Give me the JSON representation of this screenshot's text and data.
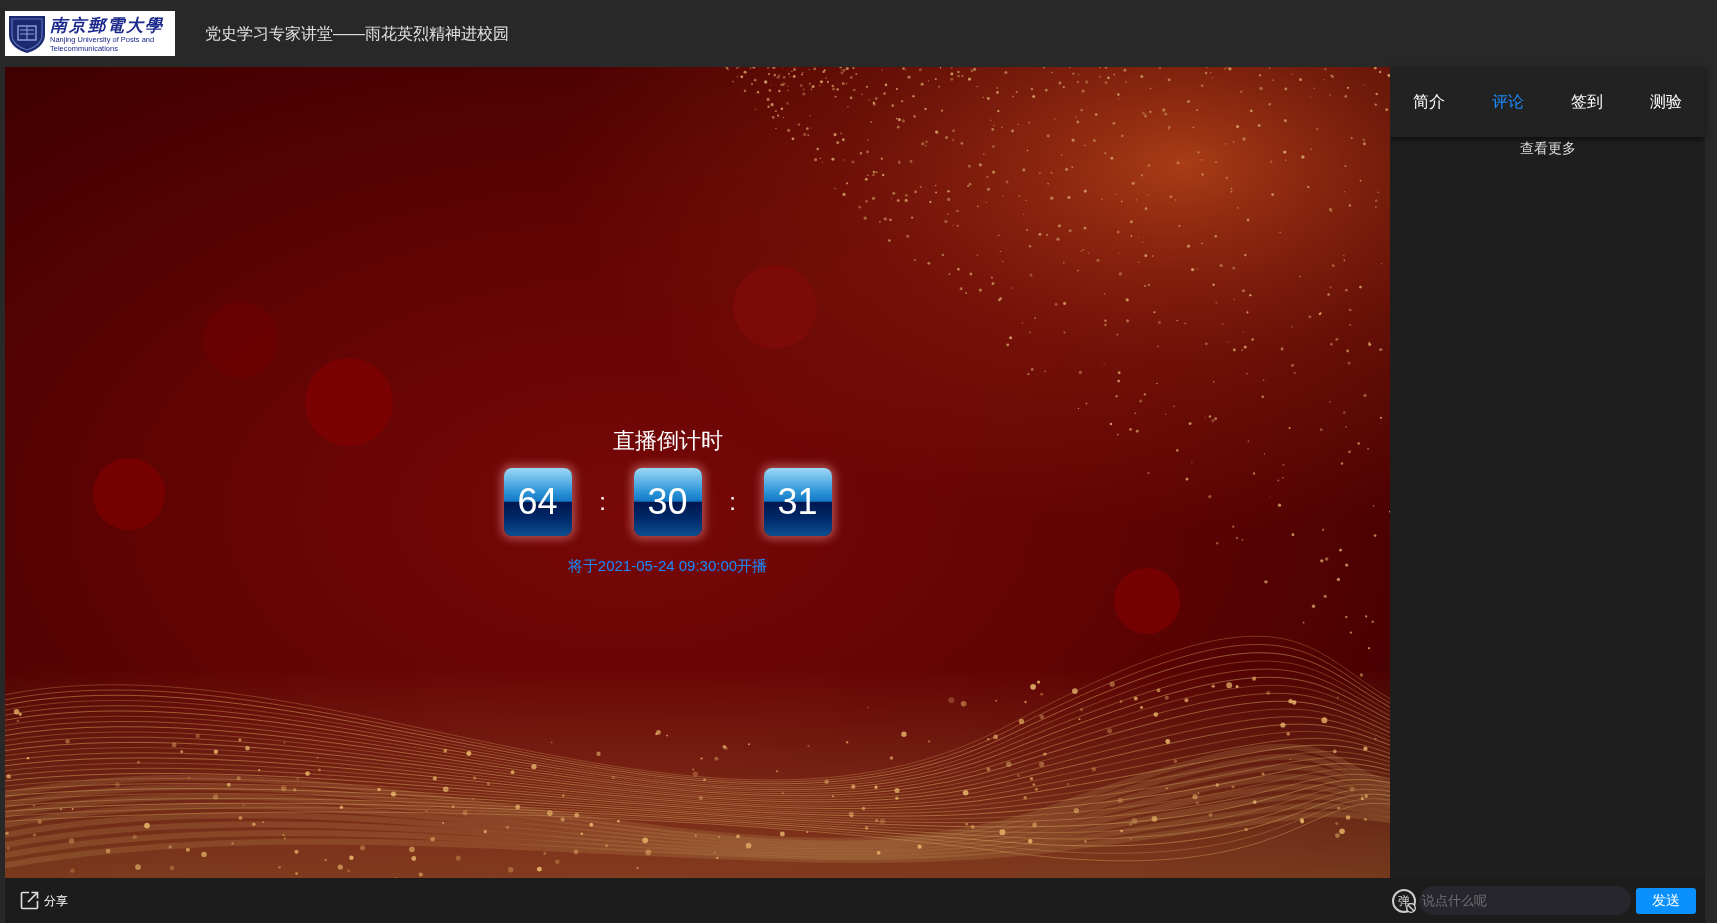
{
  "header": {
    "logo": {
      "name_cn": "南京郵電大學",
      "name_en": "Nanjing University of Posts and Telecommunications"
    },
    "title": "党史学习专家讲堂——雨花英烈精神进校园"
  },
  "player": {
    "countdown": {
      "title": "直播倒计时",
      "units": [
        "64",
        "30",
        "31"
      ],
      "separators": [
        ":",
        ":"
      ],
      "start_note": "将于2021-05-24 09:30:00开播"
    }
  },
  "side_panel": {
    "tabs": [
      {
        "label": "简介",
        "selected": false
      },
      {
        "label": "评论",
        "selected": true
      },
      {
        "label": "签到",
        "selected": false
      },
      {
        "label": "测验",
        "selected": false
      }
    ],
    "more_link": "查看更多"
  },
  "bottom_bar": {
    "share": "分享",
    "danmaku_toggle": {
      "label": "弹",
      "enabled": false
    },
    "comment_input": {
      "placeholder": "说点什么呢"
    },
    "send_button": "发送"
  }
}
